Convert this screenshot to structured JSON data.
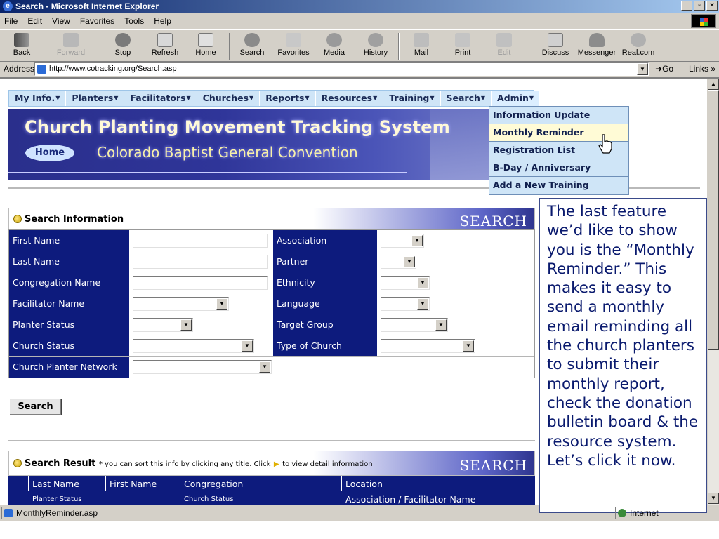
{
  "window": {
    "title": "Search - Microsoft Internet Explorer"
  },
  "menubar": [
    "File",
    "Edit",
    "View",
    "Favorites",
    "Tools",
    "Help"
  ],
  "toolbar": {
    "back": "Back",
    "forward": "Forward",
    "stop": "Stop",
    "refresh": "Refresh",
    "home": "Home",
    "search": "Search",
    "favorites": "Favorites",
    "media": "Media",
    "history": "History",
    "mail": "Mail",
    "print": "Print",
    "edit": "Edit",
    "discuss": "Discuss",
    "messenger": "Messenger",
    "real": "Real.com"
  },
  "address": {
    "label": "Address",
    "url": "http://www.cotracking.org/Search.asp",
    "go": "Go",
    "links": "Links"
  },
  "nav": [
    {
      "label": "My Info."
    },
    {
      "label": "Planters"
    },
    {
      "label": "Facilitators"
    },
    {
      "label": "Churches"
    },
    {
      "label": "Reports"
    },
    {
      "label": "Resources"
    },
    {
      "label": "Training"
    },
    {
      "label": "Search"
    },
    {
      "label": "Admin"
    }
  ],
  "banner": {
    "title": "Church Planting Movement Tracking System",
    "subtitle": "Colorado Baptist General Convention",
    "home": "Home"
  },
  "admin_menu": {
    "items": [
      "Information Update",
      "Monthly Reminder",
      "Registration List",
      "B-Day / Anniversary",
      "Add a New Training"
    ],
    "highlighted": "Monthly Reminder"
  },
  "search_section": {
    "title": "Search Information",
    "tag": "SEARCH"
  },
  "form": {
    "first_name": "First Name",
    "last_name": "Last Name",
    "congregation_name": "Congregation Name",
    "facilitator_name": "Facilitator Name",
    "planter_status": "Planter Status",
    "church_status": "Church Status",
    "church_planter_network": "Church Planter Network",
    "association": "Association",
    "partner": "Partner",
    "ethnicity": "Ethnicity",
    "language": "Language",
    "target_group": "Target Group",
    "type_of_church": "Type of Church"
  },
  "search_button": "Search",
  "result_section": {
    "title": "Search Result",
    "hint_pre": "* you can sort this info by clicking any title. Click",
    "hint_post": "to view detail information",
    "tag": "SEARCH",
    "columns": [
      "Last Name",
      "First Name",
      "Congregation",
      "Location"
    ],
    "subcolumns": [
      "Planter Status",
      "Church Status",
      "Association / Facilitator Name"
    ]
  },
  "callout": "The last feature we’d like to show you is the “Monthly Reminder.” This makes it easy to send a monthly email reminding all the church planters to submit their monthly report, check the donation bulletin board & the resource system. Let’s click it now.",
  "status": {
    "text": "MonthlyReminder.asp",
    "zone": "Internet"
  }
}
